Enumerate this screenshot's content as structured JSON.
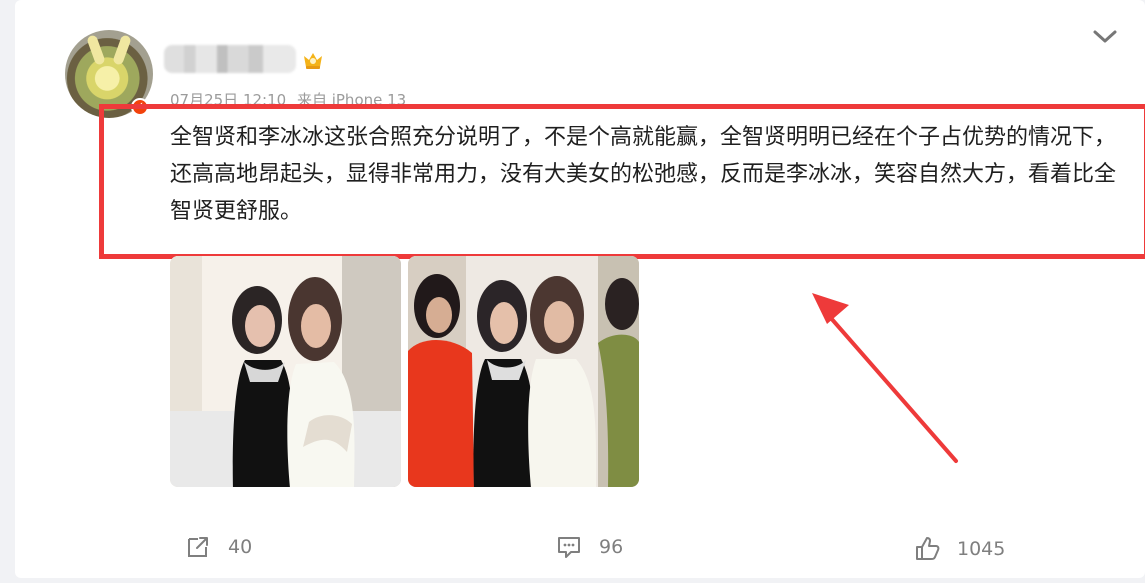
{
  "post": {
    "meta": {
      "date": "07月25日 12:10",
      "source": "来自 iPhone 13"
    },
    "text": "全智贤和李冰冰这张合照充分说明了，不是个高就能赢，全智贤明明已经在个子占优势的情况下，还高高地昂起头，显得非常用力，没有大美女的松弛感，反而是李冰冰，笑容自然大方，看着比全智贤更舒服。",
    "icons": {
      "avatar": "teletubby-avatar",
      "verified": "verified-badge-icon",
      "vip": "vip-crown-icon",
      "menu": "chevron-down-icon"
    }
  },
  "photos": {
    "first": "photo-1",
    "second": "photo-2"
  },
  "actions": {
    "share": "40",
    "comment": "96",
    "like": "1045"
  },
  "colors": {
    "highlight": "#ee3a3a",
    "meta": "#9b9b9b",
    "text": "#1f1f1f",
    "action": "#7f7f7f"
  }
}
